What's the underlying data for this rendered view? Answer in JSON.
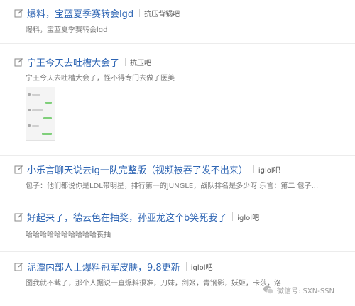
{
  "posts": [
    {
      "title": "爆料，宝蓝夏季赛转会lgd",
      "forum": "抗压背锅吧",
      "snippet": "爆料，宝蓝夏季赛转会lgd"
    },
    {
      "title": "宁王今天去吐槽大会了",
      "forum": "抗压吧",
      "snippet": "宁王今天去吐槽大会了，怪不得专门去做了医美"
    },
    {
      "title": "小乐言聊天说去ig一队完整版（视频被吞了发不出来）",
      "forum": "iglol吧",
      "snippet": "包子：他们都说你是LDL带明星，排行第一的JUNGLE，战队排名是多少呀 乐言：第二 包子..."
    },
    {
      "title": "好起来了，德云色在抽奖，孙亚龙这个b笑死我了",
      "forum": "iglol吧",
      "snippet": "哈哈哈哈哈哈哈哈哈哈丧抽"
    },
    {
      "title": "泥潭内部人士爆料冠军皮肤，9.8更新",
      "forum": "iglol吧",
      "snippet": "图我就不截了，那个人据说一直爆料很准，刀妹，剑姬，青钢影，妖姬，卡莎，洛"
    }
  ],
  "watermark": {
    "text": "微信号: SXN-SSN",
    "icon": "wechat-icon"
  },
  "colors": {
    "title": "#2d64b3",
    "snippet": "#7a7a7a",
    "forum": "#555555",
    "divider": "#ececec"
  }
}
